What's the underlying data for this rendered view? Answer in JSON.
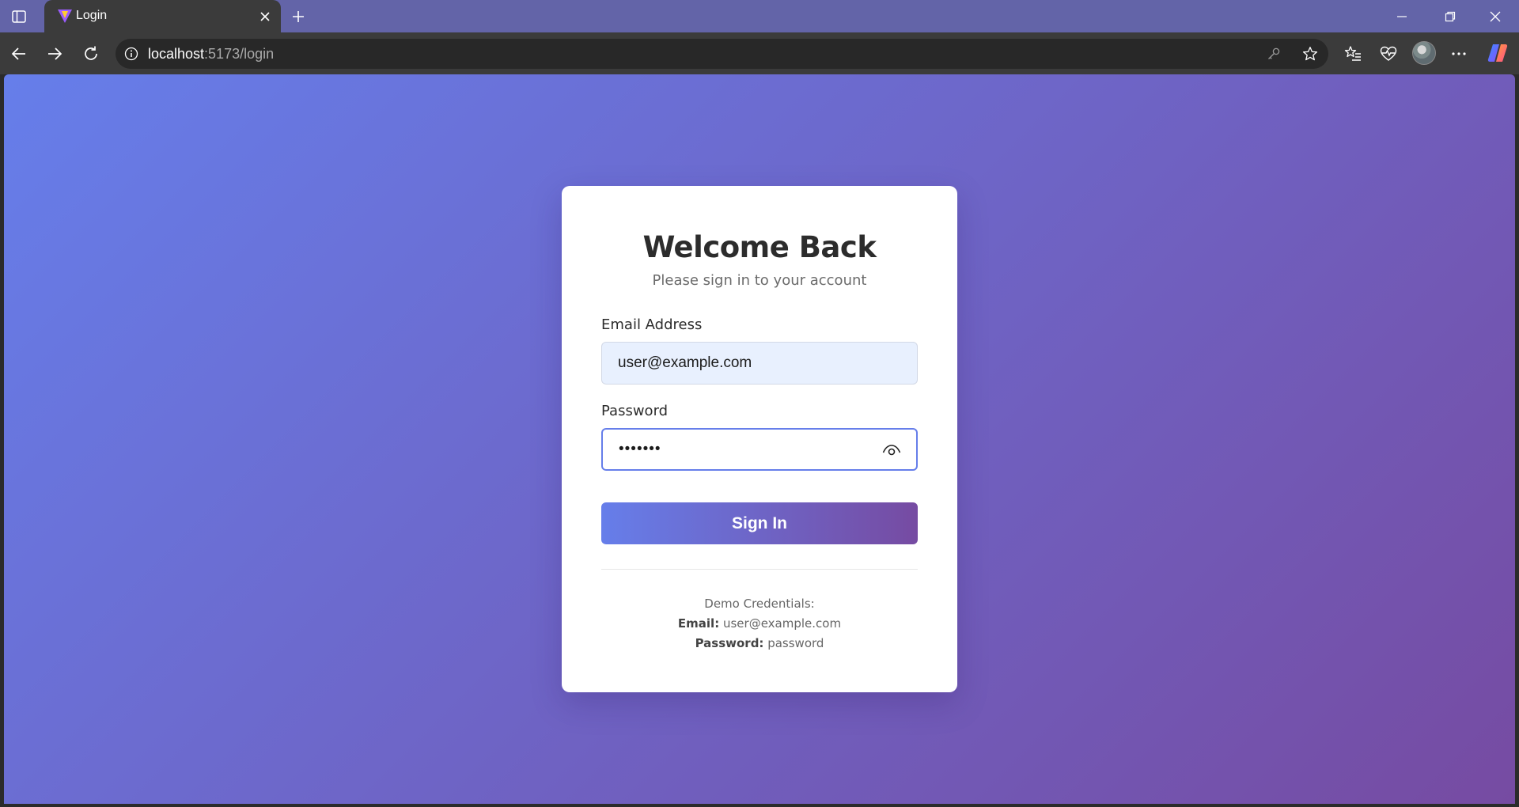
{
  "browser": {
    "tab": {
      "title": "Login"
    },
    "address_bar": {
      "host": "localhost",
      "path": ":5173/login"
    },
    "colors": {
      "tabstrip": "#6364a8",
      "toolbar": "#3b3b3b",
      "omnibox": "#282828"
    },
    "icons": {
      "sidebar": "sidebar-toggle-icon",
      "tab_favicon": "vite-logo-icon",
      "tab_close": "close-icon",
      "new_tab": "plus-icon",
      "back": "arrow-left-icon",
      "forward": "arrow-right-icon",
      "reload": "refresh-icon",
      "site_info": "info-icon",
      "password_key": "key-icon",
      "favorite": "star-icon",
      "favorites_list": "favorites-icon",
      "performance": "heartbeat-icon",
      "profile": "avatar",
      "menu": "more-icon",
      "copilot": "copilot-icon",
      "minimize": "minimize-icon",
      "restore": "restore-icon",
      "close_window": "close-window-icon"
    }
  },
  "login": {
    "title": "Welcome Back",
    "subtitle": "Please sign in to your account",
    "email": {
      "label": "Email Address",
      "value": "user@example.com"
    },
    "password": {
      "label": "Password",
      "value": "•••••••"
    },
    "submit_label": "Sign In",
    "demo": {
      "heading": "Demo Credentials:",
      "email_label": "Email:",
      "email_value": "user@example.com",
      "password_label": "Password:",
      "password_value": "password"
    },
    "colors": {
      "gradient_start": "#667eea",
      "gradient_end": "#764ba2",
      "autofill_background": "#e8f0fe"
    }
  }
}
